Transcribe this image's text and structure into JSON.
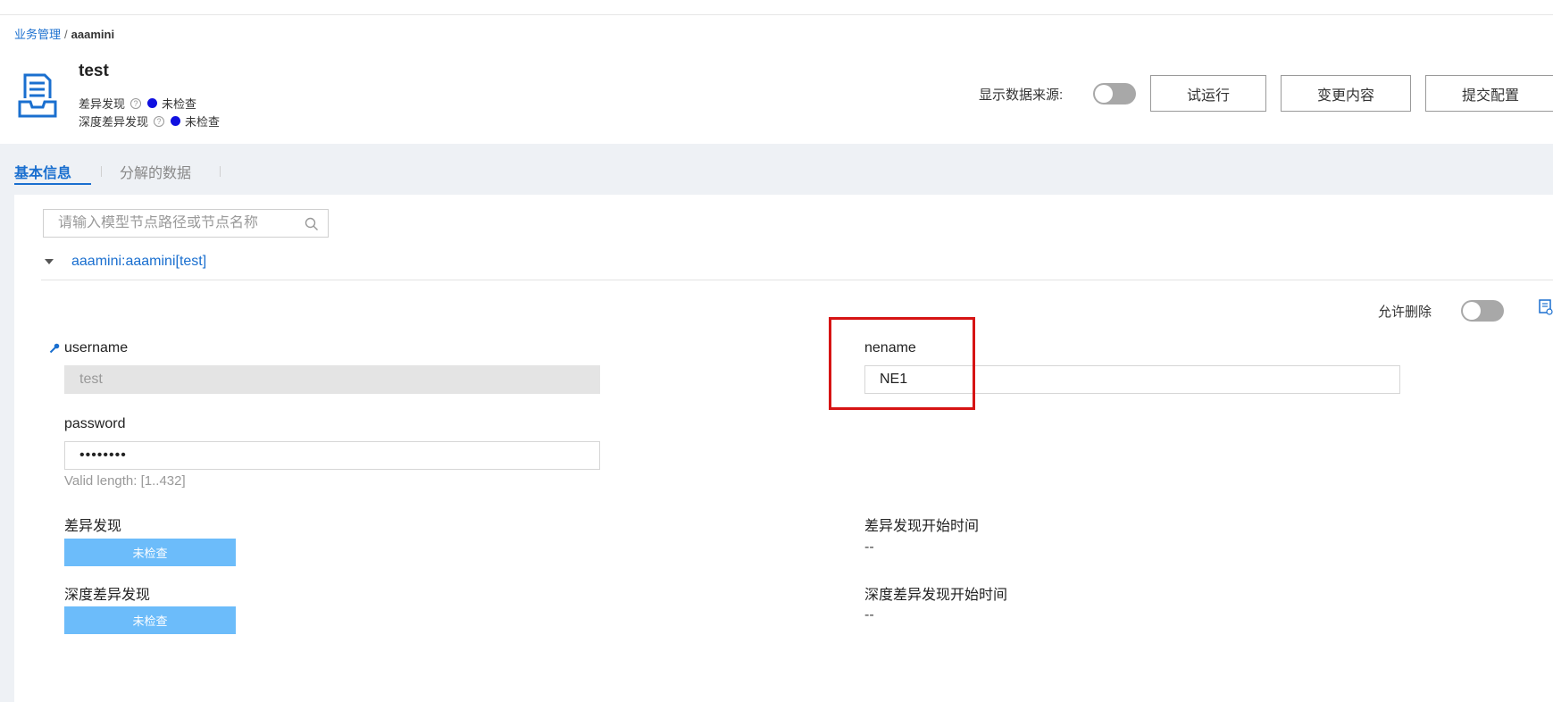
{
  "breadcrumb": {
    "root": "业务管理",
    "separator": "/",
    "current": "aaamini"
  },
  "header": {
    "title": "test",
    "status": [
      {
        "label": "差异发现",
        "help": "?",
        "value": "未检查"
      },
      {
        "label": "深度差异发现",
        "help": "?",
        "value": "未检查"
      }
    ],
    "show_source_label": "显示数据来源:",
    "buttons": {
      "trial_run": "试运行",
      "change_content": "变更内容",
      "submit_config": "提交配置"
    }
  },
  "tabs": [
    {
      "label": "基本信息",
      "active": true
    },
    {
      "label": "分解的数据",
      "active": false
    }
  ],
  "search": {
    "placeholder": "请输入模型节点路径或节点名称",
    "value": ""
  },
  "tree": {
    "node_label": "aaamini:aaamini[test]"
  },
  "allow_delete_label": "允许删除",
  "fields": {
    "username": {
      "label": "username",
      "value": "test"
    },
    "nename": {
      "label": "nename",
      "value": "NE1"
    },
    "password": {
      "label": "password",
      "value": "••••••••",
      "hint": "Valid length: [1..432]"
    },
    "diff_discovery": {
      "label": "差异发现",
      "button": "未检查"
    },
    "diff_start_time": {
      "label": "差异发现开始时间",
      "value": "--"
    },
    "deep_diff_discovery": {
      "label": "深度差异发现",
      "button": "未检查"
    },
    "deep_diff_start_time": {
      "label": "深度差异发现开始时间",
      "value": "--"
    }
  },
  "colors": {
    "link": "#1a6fcf",
    "status_dot": "#1010e0",
    "status_button": "#6cbcfa",
    "highlight": "#d61414"
  }
}
